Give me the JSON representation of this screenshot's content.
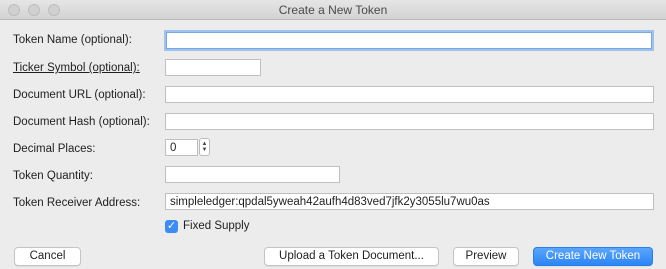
{
  "window": {
    "title": "Create a New Token"
  },
  "form": {
    "token_name": {
      "label": "Token Name (optional):",
      "value": ""
    },
    "ticker_symbol": {
      "label": "Ticker Symbol (optional):",
      "value": ""
    },
    "document_url": {
      "label": "Document URL (optional):",
      "value": ""
    },
    "document_hash": {
      "label": "Document Hash (optional):",
      "value": ""
    },
    "decimal_places": {
      "label": "Decimal Places:",
      "value": "0"
    },
    "token_quantity": {
      "label": "Token Quantity:",
      "value": ""
    },
    "receiver_address": {
      "label": "Token Receiver Address:",
      "value": "simpleledger:qpdal5yweah42aufh4d83ved7jfk2y3055lu7wu0as"
    },
    "fixed_supply": {
      "label": "Fixed Supply",
      "checked": true
    }
  },
  "buttons": {
    "cancel": "Cancel",
    "upload": "Upload a Token Document...",
    "preview": "Preview",
    "create": "Create New Token"
  },
  "icons": {
    "stepper": "stepper-arrows-icon",
    "checkmark": "checkmark-icon"
  },
  "colors": {
    "accent": "#2c84f5",
    "focus_ring": "#9fc3ef",
    "window_bg": "#ececec"
  }
}
